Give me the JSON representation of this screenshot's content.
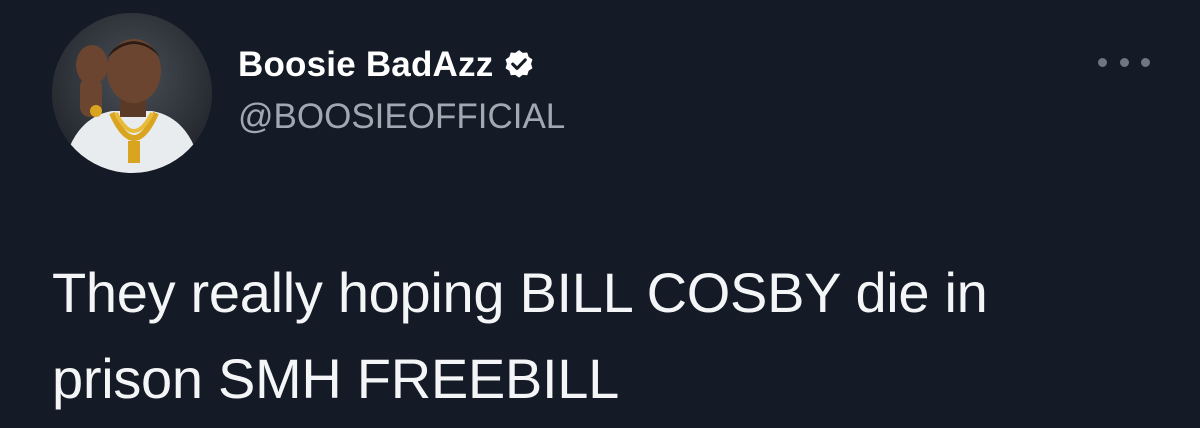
{
  "author": {
    "display_name": "Boosie BadAzz",
    "handle": "@BOOSIEOFFICIAL",
    "verified": true,
    "avatar_icon": "profile-photo"
  },
  "tweet": {
    "text_line_1": "They really hoping BILL COSBY die in",
    "text_line_2": "prison SMH FREEBILL"
  },
  "menu": {
    "icon": "more-options-icon"
  },
  "colors": {
    "background": "#151b26",
    "name": "#ffffff",
    "handle": "#a0a8b2",
    "body_text": "#f4f5f7",
    "verified_badge": "#ffffff"
  }
}
